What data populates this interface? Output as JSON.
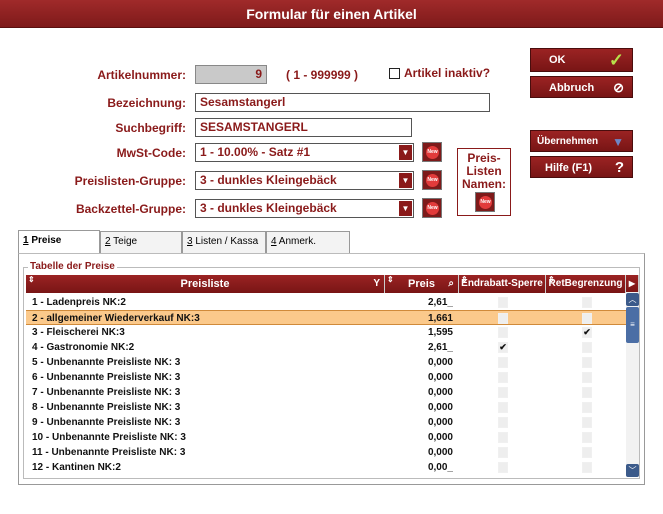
{
  "window": {
    "title": "Formular für einen Artikel"
  },
  "form": {
    "artikelnummer_label": "Artikelnummer:",
    "artikelnummer_value": "9",
    "range_hint": "( 1 - 999999 )",
    "inaktiv_label": "Artikel inaktiv?",
    "bezeichnung_label": "Bezeichnung:",
    "bezeichnung_value": "Sesamstangerl",
    "suchbegriff_label": "Suchbegriff:",
    "suchbegriff_value": "SESAMSTANGERL",
    "mwst_label": "MwSt-Code:",
    "mwst_value": "1 - 10.00% - Satz #1",
    "preislisten_gruppe_label": "Preislisten-Gruppe:",
    "preislisten_gruppe_value": "3 - dunkles Kleingebäck",
    "backzettel_gruppe_label": "Backzettel-Gruppe:",
    "backzettel_gruppe_value": "3 - dunkles Kleingebäck",
    "new_label": "New",
    "preislisten_namen_lines": [
      "Preis-",
      "Listen",
      "Namen:"
    ]
  },
  "buttons": {
    "ok": "OK",
    "abbruch": "Abbruch",
    "uebernehmen": "Übernehmen",
    "hilfe": "Hilfe (F1)"
  },
  "tabs": [
    {
      "key": "1",
      "label": " Preise"
    },
    {
      "key": "2",
      "label": " Teige"
    },
    {
      "key": "3",
      "label": " Listen / Kassa"
    },
    {
      "key": "4",
      "label": " Anmerk."
    }
  ],
  "table": {
    "group_title": "Tabelle der Preise",
    "headers": {
      "preisliste": "Preisliste",
      "preis": "Preis",
      "endrabatt": "Endrabatt-Sperre",
      "ret": "RetBegrenzung"
    },
    "rows": [
      {
        "name": "1 - Ladenpreis NK:2",
        "preis": "2,61_",
        "endrabatt": false,
        "ret": false,
        "selected": false
      },
      {
        "name": "2 - allgemeiner Wiederverkauf NK:3",
        "preis": "1,661",
        "endrabatt": false,
        "ret": false,
        "selected": true
      },
      {
        "name": "3 - Fleischerei NK:3",
        "preis": "1,595",
        "endrabatt": false,
        "ret": true,
        "selected": false
      },
      {
        "name": "4 - Gastronomie NK:2",
        "preis": "2,61_",
        "endrabatt": true,
        "ret": false,
        "selected": false
      },
      {
        "name": "5 - Unbenannte Preisliste NK: 3",
        "preis": "0,000",
        "endrabatt": false,
        "ret": false,
        "selected": false
      },
      {
        "name": "6 - Unbenannte Preisliste NK: 3",
        "preis": "0,000",
        "endrabatt": false,
        "ret": false,
        "selected": false
      },
      {
        "name": "7 - Unbenannte Preisliste NK: 3",
        "preis": "0,000",
        "endrabatt": false,
        "ret": false,
        "selected": false
      },
      {
        "name": "8 - Unbenannte Preisliste NK: 3",
        "preis": "0,000",
        "endrabatt": false,
        "ret": false,
        "selected": false
      },
      {
        "name": "9 - Unbenannte Preisliste NK: 3",
        "preis": "0,000",
        "endrabatt": false,
        "ret": false,
        "selected": false
      },
      {
        "name": "10 - Unbenannte Preisliste NK: 3",
        "preis": "0,000",
        "endrabatt": false,
        "ret": false,
        "selected": false
      },
      {
        "name": "11 - Unbenannte Preisliste NK: 3",
        "preis": "0,000",
        "endrabatt": false,
        "ret": false,
        "selected": false
      },
      {
        "name": "12 - Kantinen NK:2",
        "preis": "0,00_",
        "endrabatt": false,
        "ret": false,
        "selected": false
      }
    ]
  },
  "colors": {
    "brand": "#8a1a1a",
    "selected_row": "#fbc98b",
    "ok_check": "#b8e04a"
  }
}
